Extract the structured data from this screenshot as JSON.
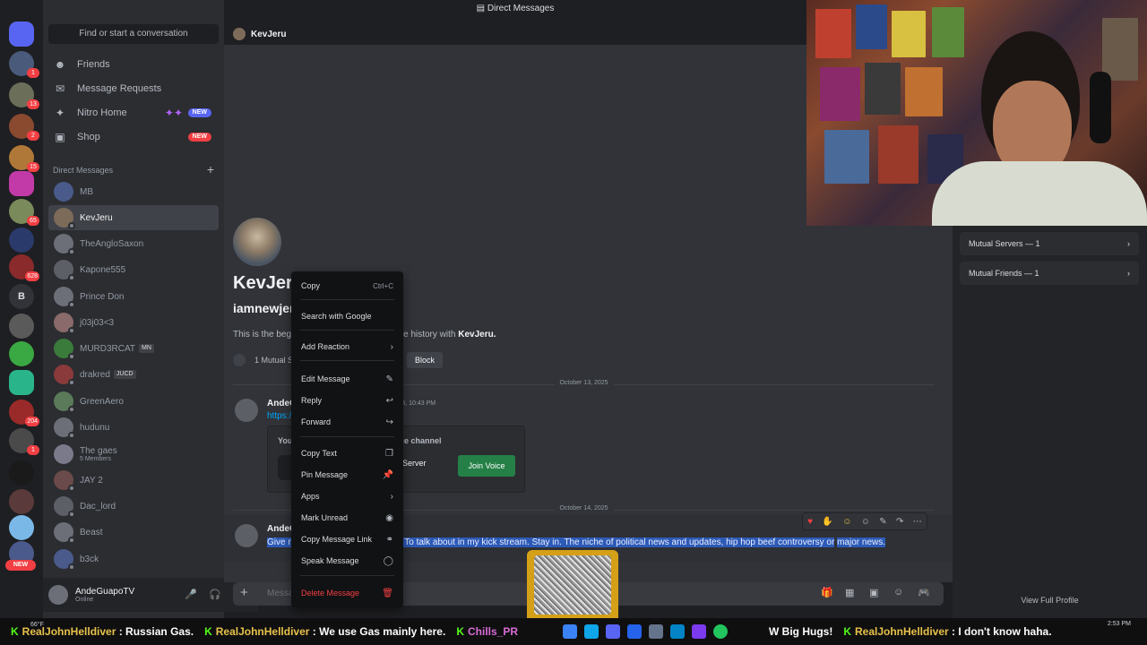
{
  "topbar": {
    "title": "Direct Messages",
    "inbox_icon": "inbox-icon"
  },
  "sidebar": {
    "search_label": "Find or start a conversation",
    "nav": [
      {
        "label": "Friends",
        "icon": "friends-icon"
      },
      {
        "label": "Message Requests",
        "icon": "mail-icon"
      },
      {
        "label": "Nitro Home",
        "icon": "nitro-icon",
        "badge": "NEW"
      },
      {
        "label": "Shop",
        "icon": "shop-icon",
        "badge": "NEW"
      }
    ],
    "dm_header": "Direct Messages",
    "dms": [
      {
        "name": "MB"
      },
      {
        "name": "KevJeru"
      },
      {
        "name": "TheAngloSaxon"
      },
      {
        "name": "Kapone555"
      },
      {
        "name": "Prince Don"
      },
      {
        "name": "j03j03<3"
      },
      {
        "name": "MURD3RCAT",
        "tag": "MN"
      },
      {
        "name": "drakred",
        "tag": "JUCD"
      },
      {
        "name": "GreenAero"
      },
      {
        "name": "hudunu"
      },
      {
        "name": "The gaes",
        "sub": "5 Members"
      },
      {
        "name": "JAY 2"
      },
      {
        "name": "Dac_lord"
      },
      {
        "name": "Beast"
      },
      {
        "name": "b3ck"
      }
    ]
  },
  "rail": {
    "badges": [
      "1",
      "13",
      "2",
      "15",
      "65",
      "628",
      "204",
      "1"
    ],
    "new_label": "NEW",
    "letter_server": "B"
  },
  "userpanel": {
    "name": "AndeGuapoTV",
    "status": "Online"
  },
  "chat": {
    "header_name": "KevJeru",
    "intro_name": "KevJeru",
    "intro_username": "iamnewjeru",
    "intro_text_prefix": "This is the beginning of your direct message history with",
    "intro_text_name": "KevJeru.",
    "mutual": "1 Mutual Server",
    "block_label": "Block",
    "date1": "October 13, 2025",
    "date2": "October 14, 2025",
    "msg1_author": "AndeGuapoTV",
    "msg1_time": "10/13/25, 10:43 PM",
    "msg1_link": "https://discord.gg/",
    "invite_title": "You've been invited to join a voice channel",
    "invite_server": "Server",
    "join_label": "Join Voice",
    "msg2_author": "AndeGuapoTV",
    "msg2_text_a": "Give me a look and highly search. To talk about in my kick stream. Stay in. The niche of political news and updates, hip hop beef controversy or",
    "msg2_text_b": "major news.",
    "composer_placeholder": "Message @KevJeru"
  },
  "profile": {
    "mutual_servers": "Mutual Servers — 1",
    "mutual_friends": "Mutual Friends — 1",
    "view_full": "View Full Profile"
  },
  "context_menu": {
    "items": [
      {
        "label": "Copy",
        "shortcut": "Ctrl+C"
      },
      {
        "label": "Search with Google"
      },
      {
        "label": "Add Reaction",
        "icon": "chevron-right-icon"
      },
      {
        "label": "Edit Message",
        "icon": "pencil-icon"
      },
      {
        "label": "Reply",
        "icon": "reply-icon"
      },
      {
        "label": "Forward",
        "icon": "forward-icon"
      },
      {
        "label": "Copy Text",
        "icon": "copy-icon"
      },
      {
        "label": "Pin Message",
        "icon": "pin-icon"
      },
      {
        "label": "Apps",
        "icon": "chevron-right-icon"
      },
      {
        "label": "Mark Unread",
        "icon": "bell-icon"
      },
      {
        "label": "Copy Message Link",
        "icon": "link-icon"
      },
      {
        "label": "Speak Message",
        "icon": "speak-icon"
      },
      {
        "label": "Delete Message",
        "icon": "trash-icon",
        "danger": true
      }
    ]
  },
  "ticker": [
    {
      "user": "RealJohnHelldiver",
      "msg": "Russian Gas."
    },
    {
      "user": "RealJohnHelldiver",
      "msg": "We use Gas mainly here."
    },
    {
      "user": "Chills_PR",
      "msg": ""
    },
    {
      "user": "",
      "msg": "W Big Hugs!"
    },
    {
      "user": "RealJohnHelldiver",
      "msg": "I don't know haha."
    }
  ],
  "clock": {
    "time": "2:53 PM",
    "temp": "66°F"
  },
  "colors": {
    "accent": "#5865f2",
    "danger": "#f23f43",
    "join": "#248046",
    "highlight": "#2d5ab7"
  }
}
